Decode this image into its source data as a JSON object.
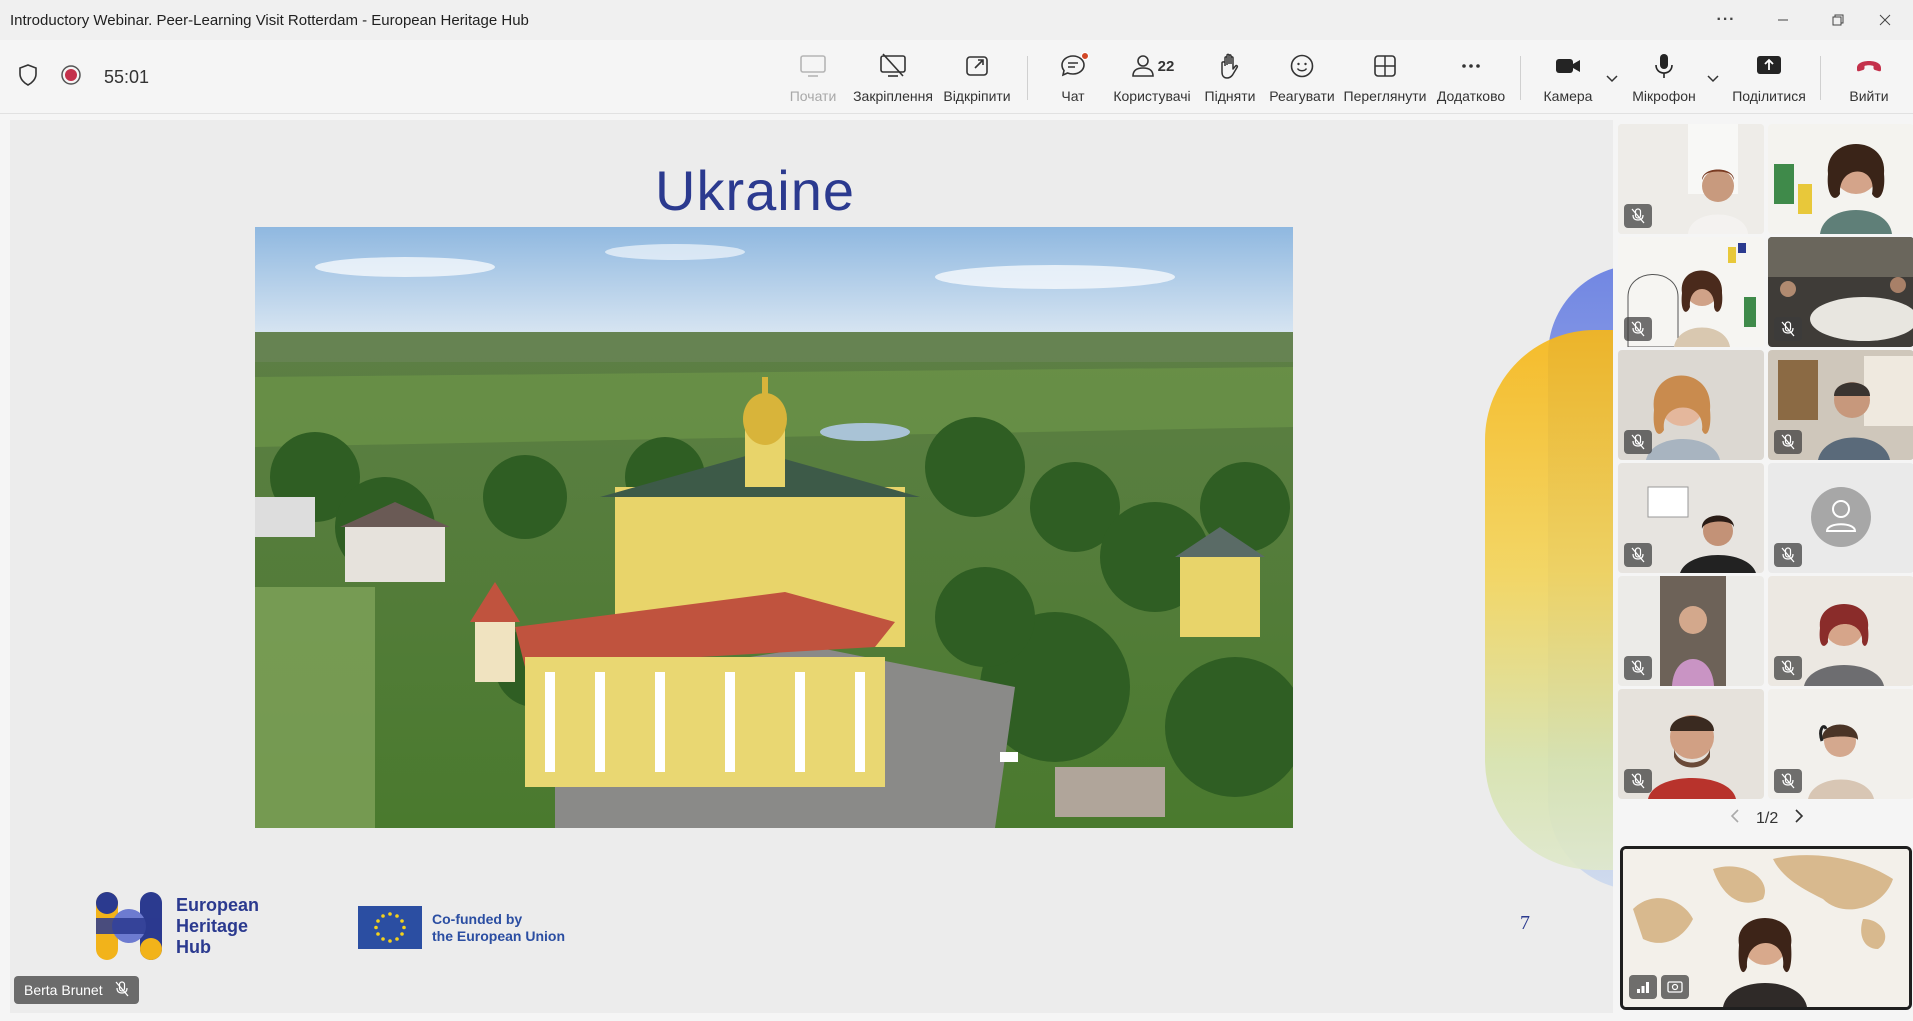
{
  "window": {
    "title": "Introductory Webinar. Peer-Learning Visit Rotterdam - European Heritage Hub",
    "more_label": "···"
  },
  "meeting": {
    "timer": "55:01",
    "participants_count": "22"
  },
  "toolbar": {
    "start_label": "Почати",
    "pin_label": "Закріплення",
    "unpin_label": "Відкріпити",
    "chat_label": "Чат",
    "users_label": "Користувачі",
    "raise_label": "Підняти",
    "react_label": "Реагувати",
    "view_label": "Переглянути",
    "more_label": "Додатково",
    "camera_label": "Камера",
    "mic_label": "Мікрофон",
    "share_label": "Поділитися",
    "leave_label": "Вийти",
    "leave_color": "#c4314b"
  },
  "slide": {
    "title": "Ukraine",
    "logo_ehh_line1": "European",
    "logo_ehh_line2": "Heritage",
    "logo_ehh_line3": "Hub",
    "eu_line1": "Co-funded by",
    "eu_line2": "the European Union",
    "page_number": "7"
  },
  "presenter": {
    "name": "Berta Brunet"
  },
  "gallery": {
    "page_indicator": "1/2"
  },
  "colors": {
    "accent": "#2b3a8f",
    "eu_blue": "#2b4ea2"
  }
}
